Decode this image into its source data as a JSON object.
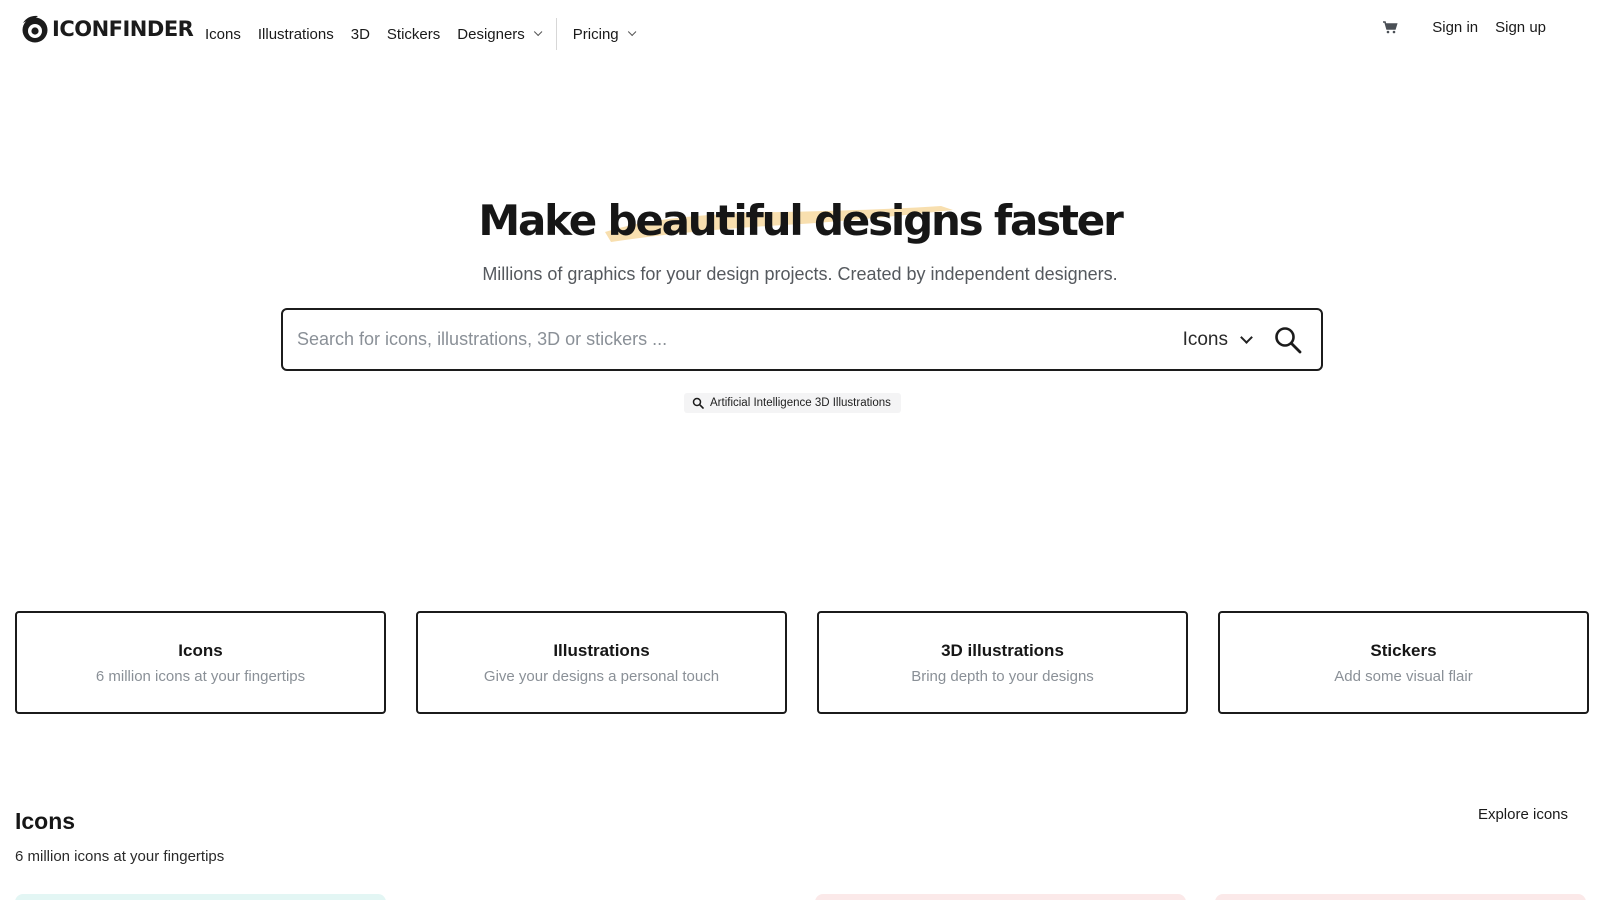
{
  "brand": {
    "name": "ICONFINDER"
  },
  "nav": {
    "items": [
      "Icons",
      "Illustrations",
      "3D",
      "Stickers"
    ],
    "designers": "Designers",
    "pricing": "Pricing"
  },
  "account": {
    "cart_icon": "cart-icon",
    "sign_in": "Sign in",
    "sign_up": "Sign up"
  },
  "hero": {
    "title_start": "Make",
    "title_highlight": "beautiful designs",
    "title_end": "faster",
    "subtitle": "Millions of graphics for your design projects. Created by independent designers."
  },
  "search": {
    "placeholder": "Search for icons, illustrations, 3D or stickers ...",
    "value": "",
    "type_selected": "Icons",
    "suggestion": "Artificial Intelligence 3D Illustrations"
  },
  "categories": [
    {
      "title": "Icons",
      "subtitle": "6 million icons at your fingertips"
    },
    {
      "title": "Illustrations",
      "subtitle": "Give your designs a personal touch"
    },
    {
      "title": "3D illustrations",
      "subtitle": "Bring depth to your designs"
    },
    {
      "title": "Stickers",
      "subtitle": "Add some visual flair"
    }
  ],
  "section": {
    "title": "Icons",
    "subtitle": "6 million icons at your fingertips",
    "explore_link": "Explore icons"
  },
  "colors": {
    "highlight": "#f7dca6",
    "peek_teal": "#e3f6f4",
    "peek_pink": "#fbe9e9"
  }
}
